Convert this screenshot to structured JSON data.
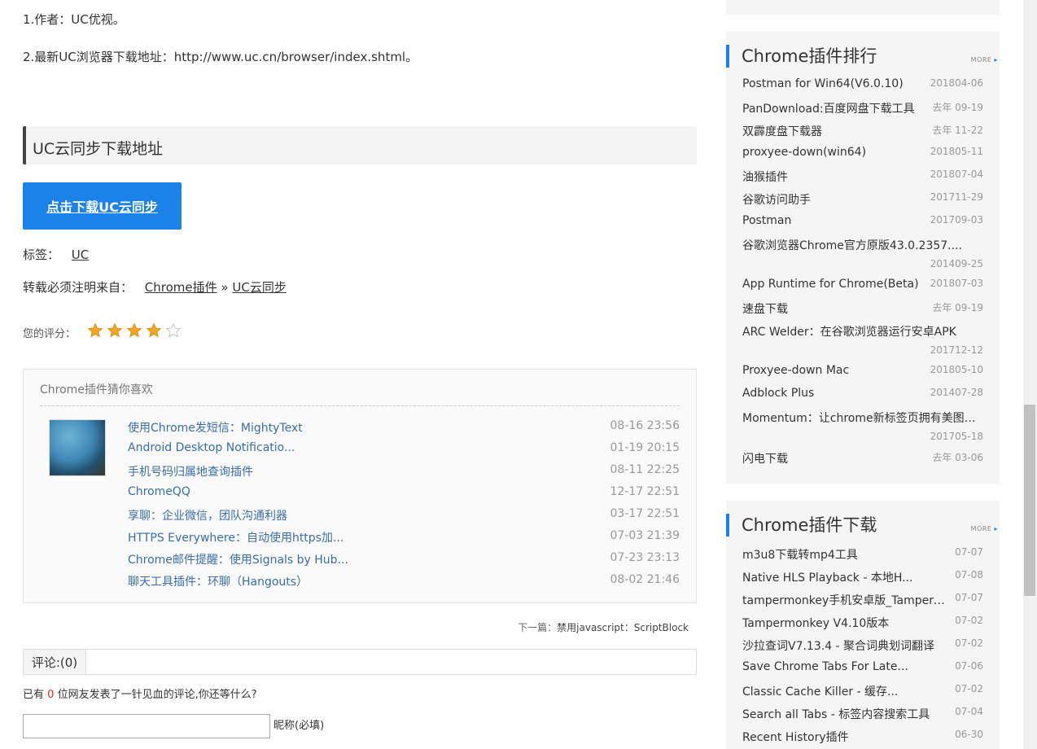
{
  "article": {
    "p1": "1.作者：UC优视。",
    "p2": "2.最新UC浏览器下载地址：http://www.uc.cn/browser/index.shtml。",
    "section_heading": "UC云同步下载地址",
    "download_button": "点击下载UC云同步",
    "tags_label": "标签：",
    "tag": "UC",
    "source_label": "转载必须注明来自：",
    "source_link1": "Chrome插件",
    "source_sep": "»",
    "source_link2": "UC云同步",
    "rating_label": "您的评分：",
    "rating_value": 4,
    "rating_max": 5
  },
  "like": {
    "title": "Chrome插件猜你喜欢",
    "items": [
      {
        "title": "使用Chrome发短信：MightyText",
        "date": "08-16 23:56"
      },
      {
        "title": "Android Desktop Notificatio...",
        "date": "01-19 20:15"
      },
      {
        "title": "手机号码归属地查询插件",
        "date": "08-11 22:25"
      },
      {
        "title": "ChromeQQ",
        "date": "12-17 22:51"
      },
      {
        "title": "享聊：企业微信，团队沟通利器",
        "date": "03-17 22:51"
      },
      {
        "title": "HTTPS Everywhere：自动使用https加...",
        "date": "07-03 21:39"
      },
      {
        "title": "Chrome邮件提醒：使用Signals by Hub...",
        "date": "07-23 23:13"
      },
      {
        "title": "聊天工具插件：环聊（Hangouts）",
        "date": "08-02 21:46"
      }
    ]
  },
  "next": {
    "label": "下一篇：",
    "title": "禁用javascript：ScriptBlock"
  },
  "comments": {
    "tab_label": "评论:(0)",
    "count_prefix": "已有",
    "count": "0",
    "count_suffix": "位网友发表了一针见血的评论,你还等什么?",
    "nickname_label": "昵称(必填)"
  },
  "sidebar": {
    "ranking": {
      "title": "Chrome插件排行",
      "more": "MORE",
      "items": [
        {
          "title": "Postman for Win64(V6.0.10)",
          "date": "201804-06"
        },
        {
          "title": "PanDownload:百度网盘下载工具",
          "date": "去年 09-19"
        },
        {
          "title": "双霹度盘下载器",
          "date": "去年 11-22"
        },
        {
          "title": "proxyee-down(win64)",
          "date": "201805-11"
        },
        {
          "title": "油猴插件",
          "date": "201807-04"
        },
        {
          "title": "谷歌访问助手",
          "date": "201711-29"
        },
        {
          "title": "Postman",
          "date": "201709-03"
        },
        {
          "title": "谷歌浏览器Chrome官方原版43.0.2357....",
          "date": "201409-25"
        },
        {
          "title": "App Runtime for Chrome(Beta)",
          "date": "201807-03"
        },
        {
          "title": "速盘下载",
          "date": "去年 09-19"
        },
        {
          "title": "ARC Welder：在谷歌浏览器运行安卓APK",
          "date": "201712-12"
        },
        {
          "title": "Proxyee-down Mac",
          "date": "201805-10"
        },
        {
          "title": "Adblock Plus",
          "date": "201407-28"
        },
        {
          "title": "Momentum：让chrome新标签页拥有美图、...",
          "date": "201705-18"
        },
        {
          "title": "闪电下载",
          "date": "去年 03-06"
        }
      ]
    },
    "downloads": {
      "title": "Chrome插件下载",
      "more": "MORE",
      "items": [
        {
          "title": "m3u8下载转mp4工具",
          "date": "07-07"
        },
        {
          "title": "Native HLS Playback - 本地H...",
          "date": "07-08"
        },
        {
          "title": "tampermonkey手机安卓版_Tamperm...",
          "date": "07-07"
        },
        {
          "title": "Tampermonkey V4.10版本",
          "date": "07-02"
        },
        {
          "title": "沙拉查词V7.13.4 - 聚合词典划词翻译",
          "date": "07-02"
        },
        {
          "title": "Save Chrome Tabs For Late...",
          "date": "07-06"
        },
        {
          "title": "Classic Cache Killer - 缓存...",
          "date": "07-02"
        },
        {
          "title": "Search all Tabs - 标签内容搜索工具",
          "date": "07-04"
        },
        {
          "title": "Recent History插件",
          "date": "06-30"
        }
      ]
    }
  },
  "colors": {
    "accent": "#1a82e8",
    "star": "#f5a623",
    "link": "#3b6ea5",
    "count_red": "#e22222"
  }
}
